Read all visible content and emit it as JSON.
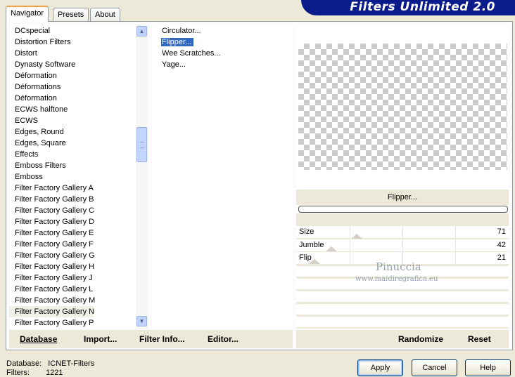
{
  "tabs": [
    {
      "label": "Navigator",
      "active": true
    },
    {
      "label": "Presets",
      "active": false
    },
    {
      "label": "About",
      "active": false
    }
  ],
  "banner_title": "Filters Unlimited 2.0",
  "categories": [
    "DCspecial",
    "Distortion Filters",
    "Distort",
    "Dynasty Software",
    "Déformation",
    "Déformations",
    "Déformation",
    "ECWS halftone",
    "ECWS",
    "Edges, Round",
    "Edges, Square",
    "Effects",
    "Emboss Filters",
    "Emboss",
    "Filter Factory Gallery A",
    "Filter Factory Gallery B",
    "Filter Factory Gallery C",
    "Filter Factory Gallery D",
    "Filter Factory Gallery E",
    "Filter Factory Gallery F",
    "Filter Factory Gallery G",
    "Filter Factory Gallery H",
    "Filter Factory Gallery J",
    "Filter Factory Gallery L",
    "Filter Factory Gallery M",
    "Filter Factory Gallery N",
    "Filter Factory Gallery P"
  ],
  "selected_category": "Filter Factory Gallery N",
  "filters": [
    "Circulator...",
    "Flipper...",
    "Wee Scratches...",
    "Yage..."
  ],
  "selected_filter": "Flipper...",
  "current_filter_name": "Flipper...",
  "progress": 0,
  "sliders": [
    {
      "label": "Size",
      "value": "71",
      "level": 0.28
    },
    {
      "label": "Jumble",
      "value": "42",
      "level": 0.16
    },
    {
      "label": "Flip",
      "value": "21",
      "level": 0.08
    }
  ],
  "watermark": {
    "name": "Pinuccia",
    "url": "www.maidiregrafica.eu"
  },
  "toolbar": {
    "database": "Database",
    "import": "Import...",
    "filter_info": "Filter Info...",
    "editor": "Editor...",
    "randomize": "Randomize",
    "reset": "Reset"
  },
  "status": {
    "database_label": "Database:",
    "database_value": "ICNET-Filters",
    "filters_label": "Filters:",
    "filters_value": "1221"
  },
  "buttons": {
    "apply": "Apply",
    "cancel": "Cancel",
    "help": "Help"
  },
  "colors": {
    "banner": "#0a1c8a",
    "selection": "#316ac5",
    "dialog_bg": "#ece9d8"
  }
}
